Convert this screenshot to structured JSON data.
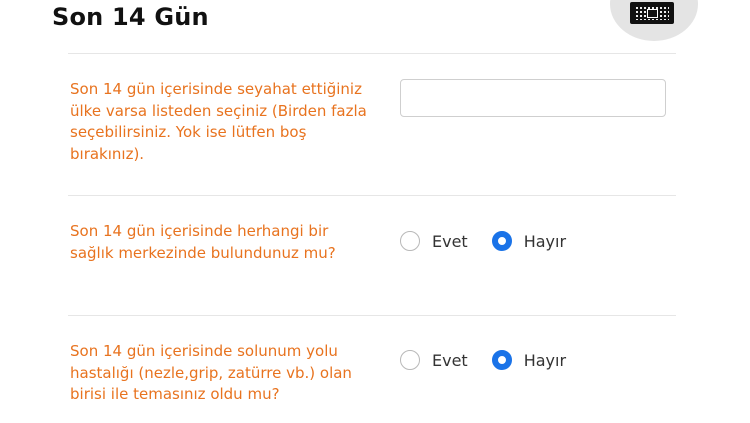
{
  "header": {
    "title": "Son 14 Gün"
  },
  "questions": [
    {
      "label": "Son 14 gün içerisinde seyahat ettiğiniz ülke varsa listeden seçiniz (Birden fazla seçebilirsiniz. Yok ise lütfen boş bırakınız).",
      "type": "select",
      "value": ""
    },
    {
      "label": "Son 14 gün içerisinde herhangi bir sağlık merkezinde bulundunuz mu?",
      "type": "radio",
      "options": [
        "Evet",
        "Hayır"
      ],
      "selected": "Hayır"
    },
    {
      "label": "Son 14 gün içerisinde solunum yolu hastalığı (nezle,grip, zatürre vb.) olan birisi ile temasınız oldu mu?",
      "type": "radio",
      "options": [
        "Evet",
        "Hayır"
      ],
      "selected": "Hayır"
    }
  ],
  "icons": {
    "qr": "qr-code-icon"
  },
  "colors": {
    "label": "#e8731f",
    "radio_selected": "#1a73e8",
    "title": "#111111"
  }
}
